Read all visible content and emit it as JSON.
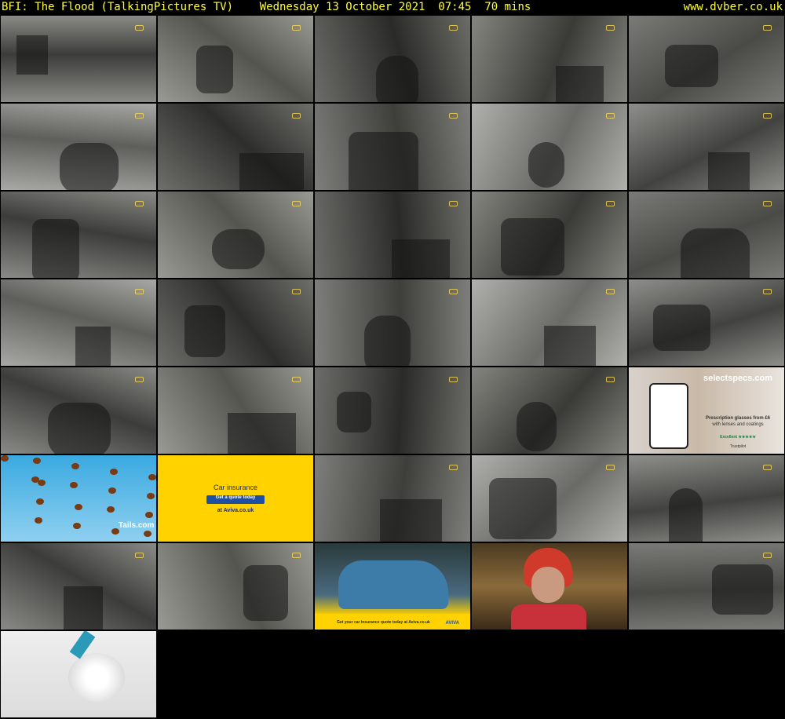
{
  "header": {
    "title": "BFI: The Flood (TalkingPictures TV)    Wednesday 13 October 2021  07:45  70 mins",
    "site": "www.dvber.co.uk"
  },
  "colors": {
    "header_text": "#ffff33",
    "background": "#000000",
    "aviva_yellow": "#ffd200",
    "aviva_button": "#1d4fa3"
  },
  "thumbnails": [
    {
      "kind": "bw",
      "tone": "river-weir"
    },
    {
      "kind": "bw",
      "tone": "marsh-figures"
    },
    {
      "kind": "bw",
      "tone": "kitchen-radio"
    },
    {
      "kind": "bw",
      "tone": "table-women"
    },
    {
      "kind": "bw",
      "tone": "lorry-yard"
    },
    {
      "kind": "bw",
      "tone": "woman-mirror"
    },
    {
      "kind": "bw",
      "tone": "shop-shelves"
    },
    {
      "kind": "bw",
      "tone": "kitchen-counter"
    },
    {
      "kind": "bw",
      "tone": "man-river-post"
    },
    {
      "kind": "bw",
      "tone": "children-comic"
    },
    {
      "kind": "bw",
      "tone": "landrover"
    },
    {
      "kind": "bw",
      "tone": "man-girl-porch"
    },
    {
      "kind": "bw",
      "tone": "two-boys"
    },
    {
      "kind": "bw",
      "tone": "road-motorbike"
    },
    {
      "kind": "bw",
      "tone": "flooded-fields"
    },
    {
      "kind": "bw",
      "tone": "boys-window"
    },
    {
      "kind": "bw",
      "tone": "dark-yard"
    },
    {
      "kind": "bw",
      "tone": "boy-kitchen"
    },
    {
      "kind": "bw",
      "tone": "blurred-pillars"
    },
    {
      "kind": "bw",
      "tone": "lorry-flood"
    },
    {
      "kind": "bw",
      "tone": "lorry-cab-boys"
    },
    {
      "kind": "bw",
      "tone": "lorry-bushes"
    },
    {
      "kind": "bw",
      "tone": "leather-jackets"
    },
    {
      "kind": "bw",
      "tone": "night-scene"
    },
    {
      "kind": "ad-selectspecs",
      "brand": "selectspecs.com",
      "line1": "Prescription glasses from £6",
      "line2": "with lenses and coatings",
      "rating": "Excellent ★★★★★",
      "footer": "Trustpilot"
    },
    {
      "kind": "ad-tails",
      "brand": "Tails.com"
    },
    {
      "kind": "ad-aviva",
      "line1": "Car insurance",
      "button": "Get a quote today",
      "line2": "at Aviva.co.uk"
    },
    {
      "kind": "bw",
      "tone": "villagers-mud"
    },
    {
      "kind": "bw",
      "tone": "nurse-doorway"
    },
    {
      "kind": "bw",
      "tone": "mud-children"
    },
    {
      "kind": "bw",
      "tone": "telephone-box"
    },
    {
      "kind": "bw",
      "tone": "children-table"
    },
    {
      "kind": "ad-aviva-car",
      "footer": "Get your car insurance quote today at Aviva.co.uk",
      "brand": "AVIVA"
    },
    {
      "kind": "colour-helmet",
      "tone": "woman-helmet"
    },
    {
      "kind": "bw",
      "tone": "wading-river"
    },
    {
      "kind": "white-brush",
      "tone": "brush"
    }
  ]
}
